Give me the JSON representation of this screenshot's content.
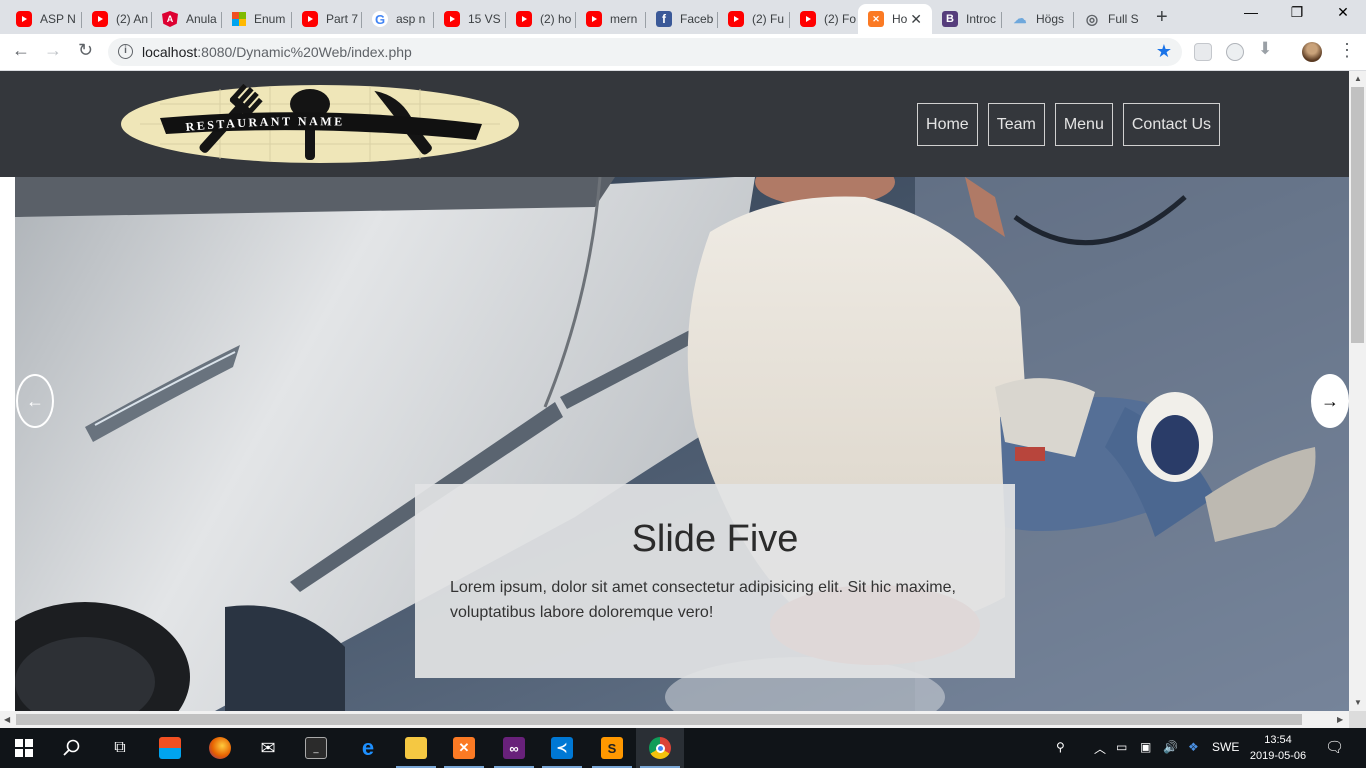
{
  "browser": {
    "tabs": [
      {
        "label": "ASP N",
        "favicon": "youtube-icon"
      },
      {
        "label": "(2) An",
        "favicon": "youtube-icon"
      },
      {
        "label": "Anula",
        "favicon": "angular-icon"
      },
      {
        "label": "Enum",
        "favicon": "microsoft-icon"
      },
      {
        "label": "Part 7",
        "favicon": "youtube-icon"
      },
      {
        "label": "asp n",
        "favicon": "google-icon"
      },
      {
        "label": "15 VS",
        "favicon": "youtube-icon"
      },
      {
        "label": "(2) ho",
        "favicon": "youtube-icon"
      },
      {
        "label": "mern",
        "favicon": "youtube-icon"
      },
      {
        "label": "Faceb",
        "favicon": "facebook-icon"
      },
      {
        "label": "(2) Fu",
        "favicon": "youtube-icon"
      },
      {
        "label": "(2) Fo",
        "favicon": "youtube-icon"
      },
      {
        "label": "Ho",
        "favicon": "xampp-icon",
        "active": true
      },
      {
        "label": "Introc",
        "favicon": "bootstrap-icon"
      },
      {
        "label": "Högs",
        "favicon": "cloud-icon"
      },
      {
        "label": "Full S",
        "favicon": "globe-icon"
      }
    ],
    "url_host": "localhost",
    "url_path": ":8080/Dynamic%20Web/index.php"
  },
  "site": {
    "logo_text": "RESTAURANT NAME",
    "nav": [
      "Home",
      "Team",
      "Menu",
      "Contact Us"
    ]
  },
  "carousel": {
    "title": "Slide Five",
    "text": "Lorem ipsum, dolor sit amet consectetur adipisicing elit. Sit hic maxime, voluptatibus labore doloremque vero!"
  },
  "taskbar": {
    "language": "SWE",
    "time": "13:54",
    "date": "2019-05-06"
  },
  "colors": {
    "header_bg": "#34373c",
    "caption_bg": "#e2e3e4",
    "logo_bg": "#efe6b8",
    "accent_star": "#1a73e8"
  }
}
